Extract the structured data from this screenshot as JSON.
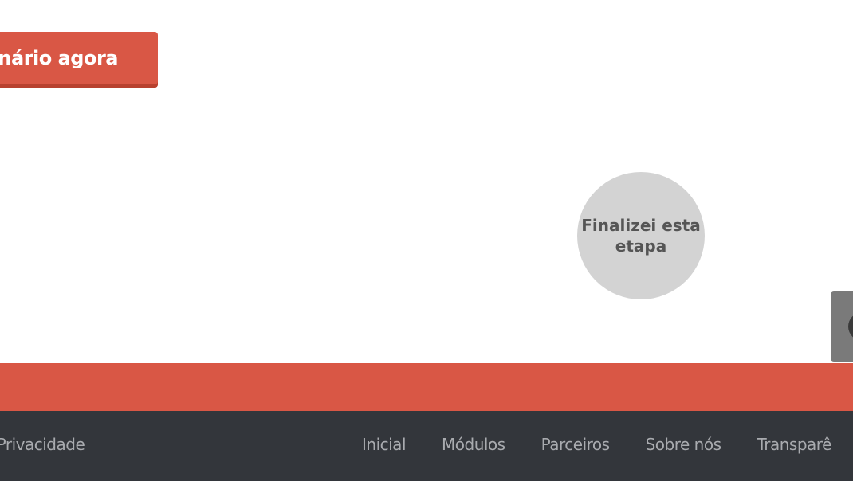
{
  "cta": {
    "label": "nário agora"
  },
  "finish_step": {
    "label": "Finalizei esta etapa"
  },
  "footer": {
    "privacy_link": "e Privacidade",
    "nav": [
      {
        "label": "Inicial"
      },
      {
        "label": "Módulos"
      },
      {
        "label": "Parceiros"
      },
      {
        "label": "Sobre nós"
      },
      {
        "label": "Transparê"
      }
    ]
  },
  "colors": {
    "accent": "#d95745",
    "footer_bg": "#33363b",
    "circle_bg": "#d3d3d3",
    "side_tab_bg": "#7a7a7a"
  }
}
